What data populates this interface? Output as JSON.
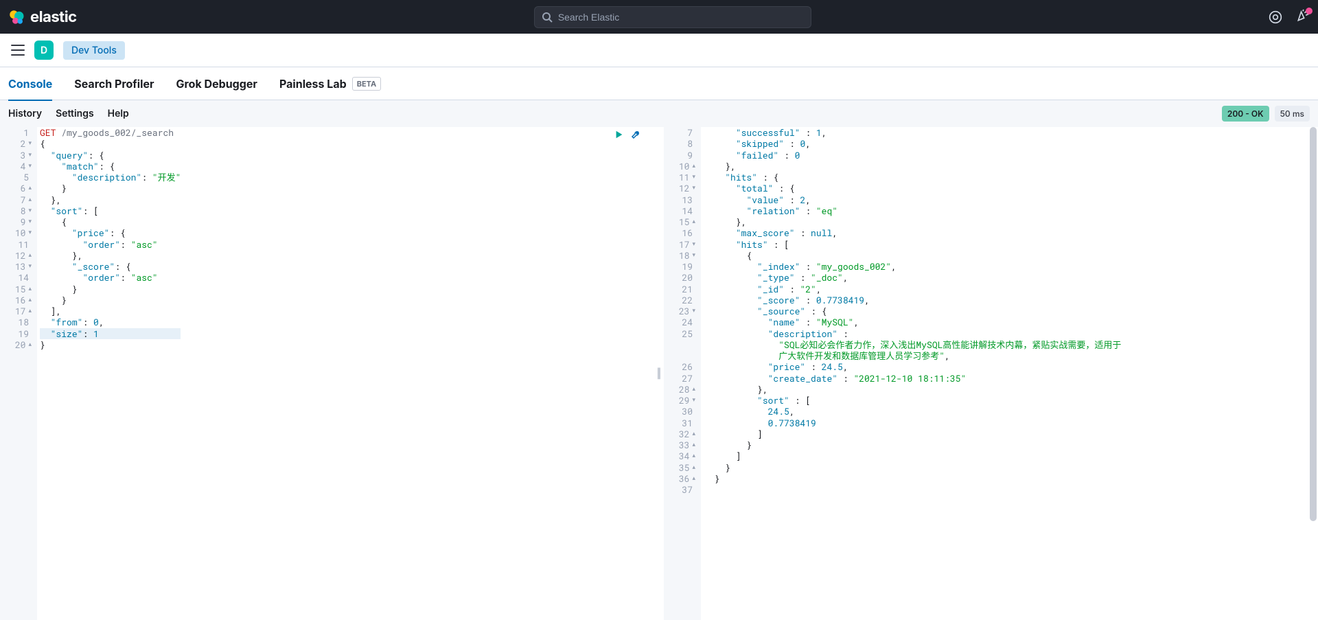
{
  "top": {
    "brand": "elastic",
    "search_placeholder": "Search Elastic"
  },
  "subbar": {
    "space_letter": "D",
    "breadcrumb": "Dev Tools"
  },
  "tabs": [
    {
      "label": "Console",
      "active": true
    },
    {
      "label": "Search Profiler",
      "active": false
    },
    {
      "label": "Grok Debugger",
      "active": false
    },
    {
      "label": "Painless Lab",
      "active": false,
      "beta": "BETA"
    }
  ],
  "toolbar": {
    "history": "History",
    "settings": "Settings",
    "help": "Help",
    "status": "200 - OK",
    "time": "50 ms"
  },
  "request": {
    "method": "GET",
    "path": "/my_goods_002/_search",
    "lines": [
      {
        "n": 1,
        "fold": "",
        "html": "<span class='tok-method'>GET</span> <span class='tok-path'>/my_goods_002/_search</span>"
      },
      {
        "n": 2,
        "fold": "▾",
        "html": "{"
      },
      {
        "n": 3,
        "fold": "▾",
        "html": "  <span class='tok-key'>\"query\"</span>: {"
      },
      {
        "n": 4,
        "fold": "▾",
        "html": "    <span class='tok-key'>\"match\"</span>: {"
      },
      {
        "n": 5,
        "fold": "",
        "html": "      <span class='tok-key'>\"description\"</span>: <span class='tok-str'>\"开发\"</span>"
      },
      {
        "n": 6,
        "fold": "▴",
        "html": "    }"
      },
      {
        "n": 7,
        "fold": "▴",
        "html": "  },"
      },
      {
        "n": 8,
        "fold": "▾",
        "html": "  <span class='tok-key'>\"sort\"</span>: ["
      },
      {
        "n": 9,
        "fold": "▾",
        "html": "    {"
      },
      {
        "n": 10,
        "fold": "▾",
        "html": "      <span class='tok-key'>\"price\"</span>: {"
      },
      {
        "n": 11,
        "fold": "",
        "html": "        <span class='tok-key'>\"order\"</span>: <span class='tok-str'>\"asc\"</span>"
      },
      {
        "n": 12,
        "fold": "▴",
        "html": "      },"
      },
      {
        "n": 13,
        "fold": "▾",
        "html": "      <span class='tok-key'>\"_score\"</span>: {"
      },
      {
        "n": 14,
        "fold": "",
        "html": "        <span class='tok-key'>\"order\"</span>: <span class='tok-str'>\"asc\"</span>"
      },
      {
        "n": 15,
        "fold": "▴",
        "html": "      }"
      },
      {
        "n": 16,
        "fold": "▴",
        "html": "    }"
      },
      {
        "n": 17,
        "fold": "▴",
        "html": "  ],"
      },
      {
        "n": 18,
        "fold": "",
        "html": "  <span class='tok-key'>\"from\"</span>: <span class='tok-num'>0</span>,"
      },
      {
        "n": 19,
        "fold": "",
        "html": "  <span class='tok-key'>\"size\"</span>: <span class='tok-num'>1</span>",
        "hl": true
      },
      {
        "n": 20,
        "fold": "▴",
        "html": "}"
      }
    ]
  },
  "response": {
    "lines": [
      {
        "n": 7,
        "fold": "",
        "html": "      <span class='tok-key'>\"successful\"</span> : <span class='tok-num'>1</span>,"
      },
      {
        "n": 8,
        "fold": "",
        "html": "      <span class='tok-key'>\"skipped\"</span> : <span class='tok-num'>0</span>,"
      },
      {
        "n": 9,
        "fold": "",
        "html": "      <span class='tok-key'>\"failed\"</span> : <span class='tok-num'>0</span>"
      },
      {
        "n": 10,
        "fold": "▴",
        "html": "    },"
      },
      {
        "n": 11,
        "fold": "▾",
        "html": "    <span class='tok-key'>\"hits\"</span> : {"
      },
      {
        "n": 12,
        "fold": "▾",
        "html": "      <span class='tok-key'>\"total\"</span> : {"
      },
      {
        "n": 13,
        "fold": "",
        "html": "        <span class='tok-key'>\"value\"</span> : <span class='tok-num'>2</span>,"
      },
      {
        "n": 14,
        "fold": "",
        "html": "        <span class='tok-key'>\"relation\"</span> : <span class='tok-str'>\"eq\"</span>"
      },
      {
        "n": 15,
        "fold": "▴",
        "html": "      },"
      },
      {
        "n": 16,
        "fold": "",
        "html": "      <span class='tok-key'>\"max_score\"</span> : <span class='tok-null'>null</span>,"
      },
      {
        "n": 17,
        "fold": "▾",
        "html": "      <span class='tok-key'>\"hits\"</span> : ["
      },
      {
        "n": 18,
        "fold": "▾",
        "html": "        {"
      },
      {
        "n": 19,
        "fold": "",
        "html": "          <span class='tok-key'>\"_index\"</span> : <span class='tok-str'>\"my_goods_002\"</span>,"
      },
      {
        "n": 20,
        "fold": "",
        "html": "          <span class='tok-key'>\"_type\"</span> : <span class='tok-str'>\"_doc\"</span>,"
      },
      {
        "n": 21,
        "fold": "",
        "html": "          <span class='tok-key'>\"_id\"</span> : <span class='tok-str'>\"2\"</span>,"
      },
      {
        "n": 22,
        "fold": "",
        "html": "          <span class='tok-key'>\"_score\"</span> : <span class='tok-num'>0.7738419</span>,"
      },
      {
        "n": 23,
        "fold": "▾",
        "html": "          <span class='tok-key'>\"_source\"</span> : {"
      },
      {
        "n": 24,
        "fold": "",
        "html": "            <span class='tok-key'>\"name\"</span> : <span class='tok-str'>\"MySQL\"</span>,"
      },
      {
        "n": 25,
        "fold": "",
        "html": "            <span class='tok-key'>\"description\"</span> :",
        "wrap": true
      },
      {
        "n": "",
        "fold": "",
        "html": "              <span class='tok-str'>\"SQL必知必会作者力作，深入浅出MySQL高性能讲解技术内幕，紧贴实战需要，适用于</span>"
      },
      {
        "n": "",
        "fold": "",
        "html": "              <span class='tok-str'>广大软件开发和数据库管理人员学习参考\"</span>,"
      },
      {
        "n": 26,
        "fold": "",
        "html": "            <span class='tok-key'>\"price\"</span> : <span class='tok-num'>24.5</span>,"
      },
      {
        "n": 27,
        "fold": "",
        "html": "            <span class='tok-key'>\"create_date\"</span> : <span class='tok-str'>\"2021-12-10 18:11:35\"</span>"
      },
      {
        "n": 28,
        "fold": "▴",
        "html": "          },"
      },
      {
        "n": 29,
        "fold": "▾",
        "html": "          <span class='tok-key'>\"sort\"</span> : ["
      },
      {
        "n": 30,
        "fold": "",
        "html": "            <span class='tok-num'>24.5</span>,"
      },
      {
        "n": 31,
        "fold": "",
        "html": "            <span class='tok-num'>0.7738419</span>"
      },
      {
        "n": 32,
        "fold": "▴",
        "html": "          ]"
      },
      {
        "n": 33,
        "fold": "▴",
        "html": "        }"
      },
      {
        "n": 34,
        "fold": "▴",
        "html": "      ]"
      },
      {
        "n": 35,
        "fold": "▴",
        "html": "    }"
      },
      {
        "n": 36,
        "fold": "▴",
        "html": "  }"
      },
      {
        "n": 37,
        "fold": "",
        "html": ""
      }
    ]
  }
}
